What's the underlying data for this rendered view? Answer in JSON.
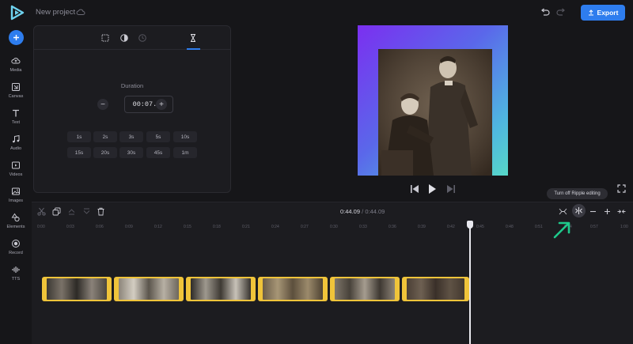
{
  "header": {
    "project_title": "New project",
    "export_label": "Export"
  },
  "sidebar": {
    "items": [
      {
        "label": "Media",
        "icon": "cloud-upload-icon"
      },
      {
        "label": "Canvas",
        "icon": "canvas-icon"
      },
      {
        "label": "Text",
        "icon": "text-icon"
      },
      {
        "label": "Audio",
        "icon": "music-note-icon"
      },
      {
        "label": "Videos",
        "icon": "video-icon"
      },
      {
        "label": "Images",
        "icon": "image-icon"
      },
      {
        "label": "Elements",
        "icon": "shapes-icon"
      },
      {
        "label": "Record",
        "icon": "record-icon"
      },
      {
        "label": "TTS",
        "icon": "waveform-icon"
      }
    ]
  },
  "panel": {
    "duration_label": "Duration",
    "duration_value": "00:07.34",
    "presets": [
      "1s",
      "2s",
      "3s",
      "5s",
      "10s",
      "15s",
      "20s",
      "30s",
      "45s",
      "1m"
    ]
  },
  "timeline": {
    "current_time": "0:44.09",
    "separator": "/",
    "total_time": "0:44.09",
    "ruler_ticks": [
      "0:00",
      "0:03",
      "0:06",
      "0:09",
      "0:12",
      "0:15",
      "0:18",
      "0:21",
      "0:24",
      "0:27",
      "0:30",
      "0:33",
      "0:36",
      "0:39",
      "0:42",
      "0:45",
      "0:48",
      "0:51",
      "0:54",
      "0:57",
      "1:00"
    ],
    "clip_count": 6
  },
  "tooltip": {
    "ripple": "Turn off Ripple editing"
  },
  "colors": {
    "accent": "#2e7dee",
    "clip_border": "#f0c43a",
    "annotation_arrow": "#1ec98b"
  }
}
